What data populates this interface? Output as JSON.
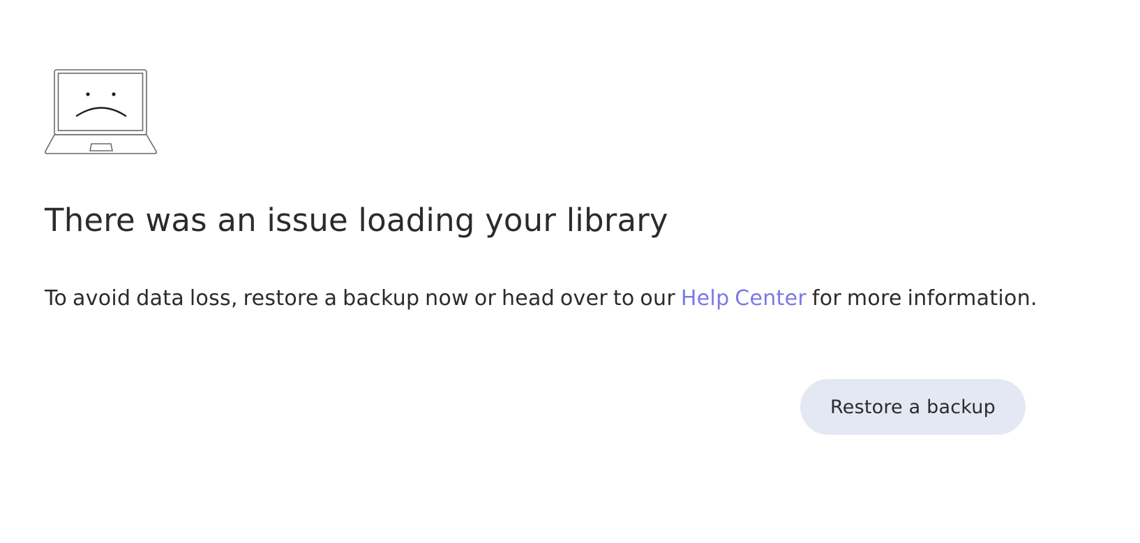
{
  "error": {
    "icon": "sad-laptop-icon",
    "title": "There was an issue loading your library",
    "message_before": "To avoid data loss, restore a backup now or head over to our ",
    "help_link_text": "Help Center",
    "message_after": " for more information."
  },
  "actions": {
    "restore_label": "Restore a backup"
  },
  "colors": {
    "text": "#2b2b2e",
    "link": "#7b78e8",
    "button_bg": "#e4e8f2",
    "icon_stroke": "#6a6a6a"
  }
}
